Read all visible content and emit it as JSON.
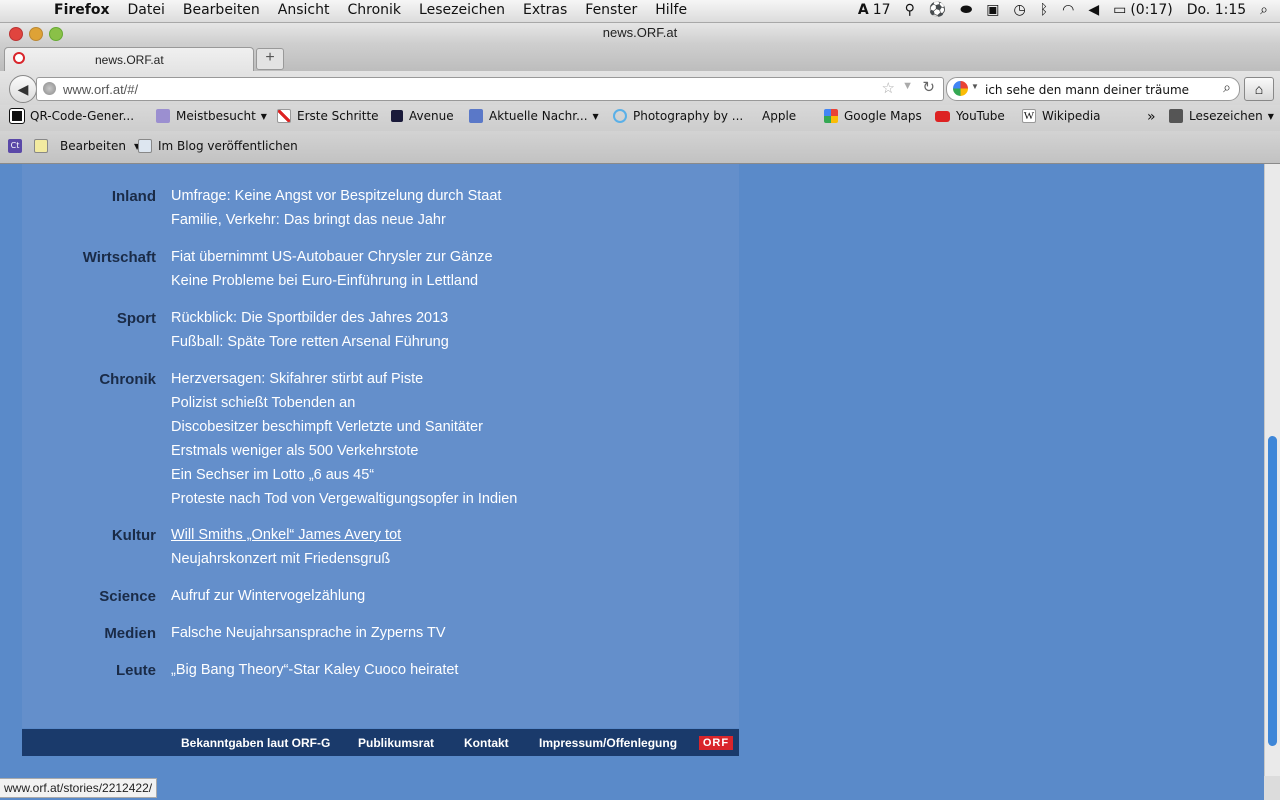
{
  "menubar": {
    "menus": [
      "Firefox",
      "Datei",
      "Bearbeiten",
      "Ansicht",
      "Chronik",
      "Lesezeichen",
      "Extras",
      "Fenster",
      "Hilfe"
    ],
    "status": {
      "adobe_count": "17",
      "battery": "(0:17)",
      "clock": "Do. 1:15"
    }
  },
  "window": {
    "title": "news.ORF.at"
  },
  "tab": {
    "title": "news.ORF.at"
  },
  "nav": {
    "url": "www.orf.at/#/",
    "search_value": "ich sehe den mann deiner träume"
  },
  "bookmarks": [
    {
      "label": "QR-Code-Gener...",
      "icon": "qr-icon"
    },
    {
      "label": "Meistbesucht",
      "icon": "folder-icon",
      "menu": true
    },
    {
      "label": "Erste Schritte",
      "icon": "firstrun-icon"
    },
    {
      "label": "Avenue",
      "icon": "avenue-icon"
    },
    {
      "label": "Aktuelle Nachr...",
      "icon": "rss-icon",
      "menu": true
    },
    {
      "label": "Photography by ...",
      "icon": "spinner-icon"
    },
    {
      "label": "Apple",
      "icon": "apple-icon"
    },
    {
      "label": "Google Maps",
      "icon": "google-icon"
    },
    {
      "label": "YouTube",
      "icon": "youtube-icon"
    },
    {
      "label": "Wikipedia",
      "icon": "wikipedia-icon"
    }
  ],
  "bookmarks_more": "»",
  "bookmarks_folder": "Lesezeichen",
  "addon": {
    "edit_label": "Bearbeiten",
    "publish_label": "Im Blog veröffentlichen"
  },
  "sections": [
    {
      "category": "Inland",
      "links": [
        "Umfrage: Keine Angst vor Bespitzelung durch Staat",
        "Familie, Verkehr: Das bringt das neue Jahr"
      ]
    },
    {
      "category": "Wirtschaft",
      "links": [
        "Fiat übernimmt US-Autobauer Chrysler zur Gänze",
        "Keine Probleme bei Euro-Einführung in Lettland"
      ]
    },
    {
      "category": "Sport",
      "links": [
        "Rückblick: Die Sportbilder des Jahres 2013",
        "Fußball: Späte Tore retten Arsenal Führung"
      ]
    },
    {
      "category": "Chronik",
      "links": [
        "Herzversagen: Skifahrer stirbt auf Piste",
        "Polizist schießt Tobenden an",
        "Discobesitzer beschimpft Verletzte und Sanitäter",
        "Erstmals weniger als 500 Verkehrstote",
        "Ein Sechser im Lotto „6 aus 45“",
        "Proteste nach Tod von Vergewaltigungsopfer in Indien"
      ]
    },
    {
      "category": "Kultur",
      "links": [
        "Will Smiths „Onkel“ James Avery tot",
        "Neujahrskonzert mit Friedensgruß"
      ]
    },
    {
      "category": "Science",
      "links": [
        "Aufruf zur Wintervogelzählung"
      ]
    },
    {
      "category": "Medien",
      "links": [
        "Falsche Neujahrsansprache in Zyperns TV"
      ]
    },
    {
      "category": "Leute",
      "links": [
        "„Big Bang Theory“-Star Kaley Cuoco heiratet"
      ]
    }
  ],
  "footer": {
    "links": [
      "Bekanntgaben laut ORF-G",
      "Publikumsrat",
      "Kontakt",
      "Impressum/Offenlegung"
    ],
    "logo": "ORF"
  },
  "status_url": "www.orf.at/stories/2212422/",
  "colors": {
    "orf_red": "#d9252b",
    "page_bg": "#5a8ac9",
    "footer_bg": "#1a3a6b"
  }
}
